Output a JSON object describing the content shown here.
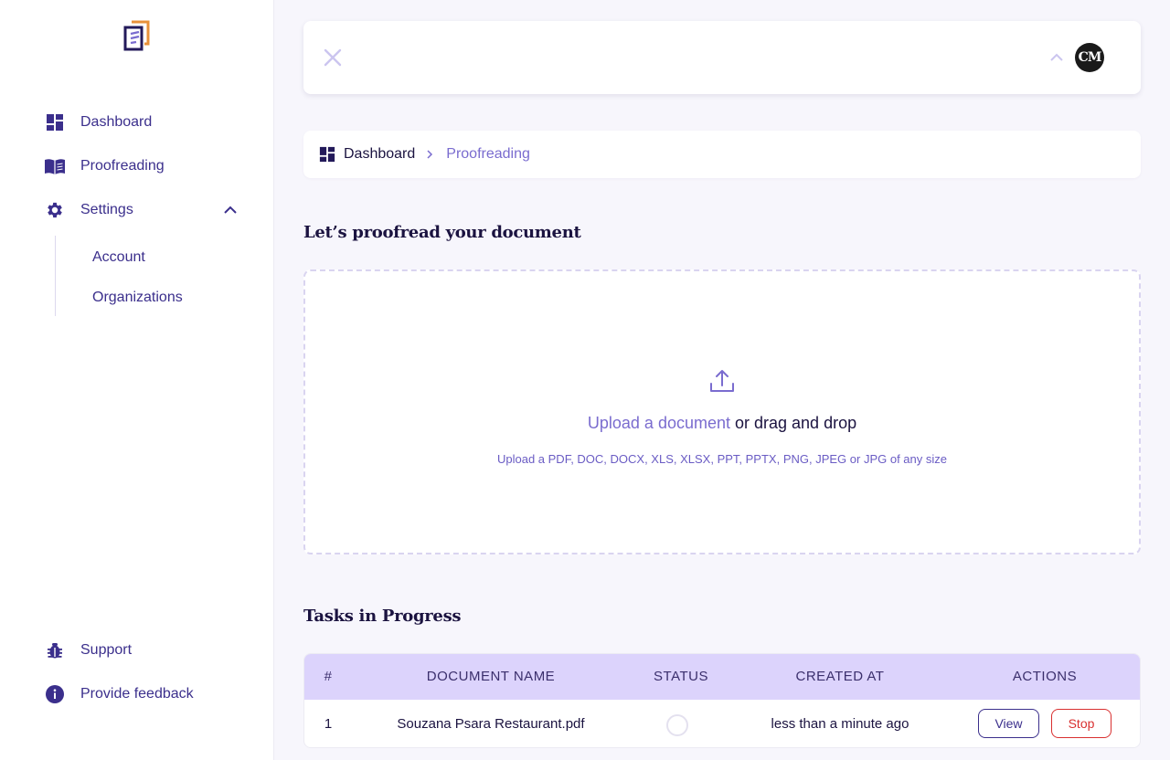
{
  "sidebar": {
    "logo_icon": "document-lines-logo",
    "nav": [
      {
        "label": "Dashboard",
        "icon": "dashboard-icon"
      },
      {
        "label": "Proofreading",
        "icon": "book-icon"
      },
      {
        "label": "Settings",
        "icon": "gear-icon"
      }
    ],
    "settings_sub": [
      {
        "label": "Account"
      },
      {
        "label": "Organizations"
      }
    ],
    "bottom": [
      {
        "label": "Support",
        "icon": "bug-icon"
      },
      {
        "label": "Provide feedback",
        "icon": "info-icon"
      }
    ]
  },
  "header": {
    "avatar_initials": "CM"
  },
  "breadcrumb": {
    "home": "Dashboard",
    "current": "Proofreading"
  },
  "upload": {
    "title": "Let’s proofread your document",
    "link": "Upload a document",
    "rest": " or drag and drop",
    "hint": "Upload a PDF, DOC, DOCX, XLS, XLSX, PPT, PPTX, PNG, JPEG or JPG of any size"
  },
  "tasks": {
    "title": "Tasks in Progress",
    "columns": [
      "#",
      "DOCUMENT NAME",
      "STATUS",
      "CREATED AT",
      "ACTIONS"
    ],
    "rows": [
      {
        "index": "1",
        "name": "Souzana Psara Restaurant.pdf",
        "status": "loading",
        "created_at": "less than a minute ago",
        "view_label": "View",
        "stop_label": "Stop"
      }
    ]
  },
  "colors": {
    "accent": "#3b2f8c",
    "accent_light": "#7a6ccf",
    "table_header": "#dcd3fc",
    "danger": "#d93030",
    "logo_orange": "#e8913a"
  }
}
